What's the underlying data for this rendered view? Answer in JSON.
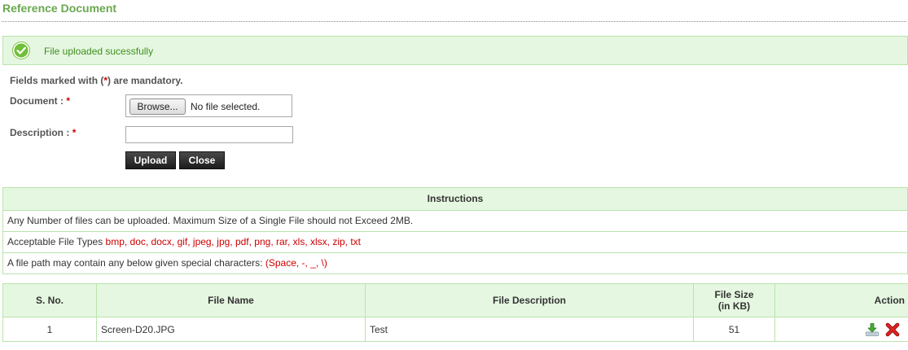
{
  "page": {
    "title": "Reference Document"
  },
  "alert": {
    "message": "File uploaded sucessfully",
    "icon": "check-circle-icon"
  },
  "form": {
    "mandatory_prefix": "Fields marked with (",
    "mandatory_star": "*",
    "mandatory_suffix": ") are mandatory.",
    "document_label": "Document :",
    "description_label": "Description :",
    "required_marker": "*",
    "browse_label": "Browse...",
    "no_file_text": "No file selected.",
    "description_value": "",
    "upload_label": "Upload",
    "close_label": "Close"
  },
  "instructions": {
    "header": "Instructions",
    "line1": "Any Number of files can be uploaded. Maximum Size of a Single File should not Exceed 2MB.",
    "line2_prefix": "Acceptable File Types",
    "line2_types": "bmp, doc, docx, gif, jpeg, jpg, pdf, png, rar, xls, xlsx, zip, txt",
    "line3_prefix": "A file path may contain any below given special characters:",
    "line3_chars": "(Space, -, _, \\)"
  },
  "table": {
    "headers": {
      "sno": "S. No.",
      "file_name": "File Name",
      "file_description": "File Description",
      "file_size_line1": "File Size",
      "file_size_line2": "(in KB)",
      "action": "Action"
    },
    "rows": [
      {
        "sno": "1",
        "file_name": "Screen-D20.JPG",
        "file_description": "Test",
        "file_size": "51"
      }
    ]
  },
  "colors": {
    "accent_green": "#6aa84f",
    "panel_bg": "#e6f7e1",
    "panel_border": "#b9e3ab",
    "required_red": "#cc0000"
  },
  "icons": {
    "download": "download-icon",
    "delete": "delete-icon"
  }
}
